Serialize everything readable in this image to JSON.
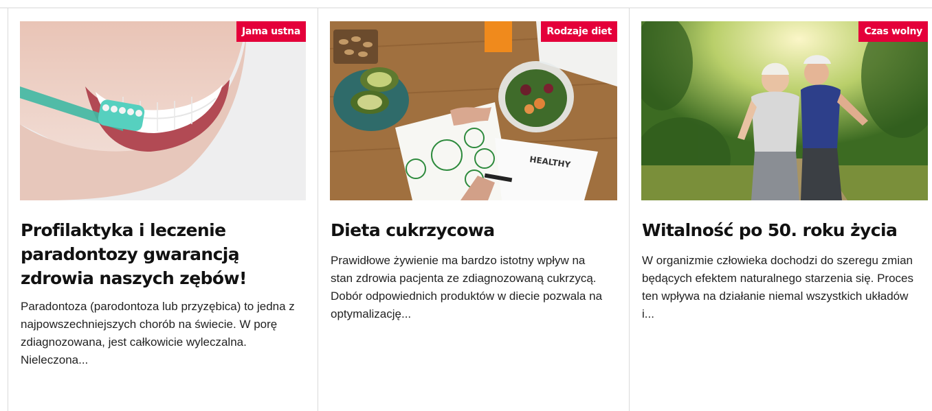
{
  "cards": [
    {
      "badge": "Jama ustna",
      "title": "Profilaktyka i leczenie paradontozy gwarancją zdrowia naszych zębów!",
      "excerpt": "Paradontoza (parodontoza lub przyzębica) to jedna z najpowszechniejszych chorób na świecie. W porę zdiagnozowana, jest całkowicie wyleczalna. Nieleczona...",
      "image": "smile-toothbrush-photo"
    },
    {
      "badge": "Rodzaje diet",
      "title": "Dieta cukrzycowa",
      "excerpt": "Prawidłowe żywienie ma bardzo istotny wpływ na stan zdrowia pacjenta ze zdiagnozowaną cukrzycą. Dobór odpowiednich produktów w diecie pozwala na optymalizację...",
      "image": "healthy-diet-notebook-photo"
    },
    {
      "badge": "Czas wolny",
      "title": "Witalność po 50.  roku życia",
      "excerpt": "W organizmie człowieka dochodzi do szeregu zmian będących efektem naturalnego starzenia się. Proces ten wpływa na działanie niemal wszystkich układów i...",
      "image": "seniors-jogging-photo"
    }
  ],
  "colors": {
    "badge_bg": "#e4003a",
    "divider": "#d9d9d9",
    "title": "#111111",
    "text": "#222222"
  }
}
